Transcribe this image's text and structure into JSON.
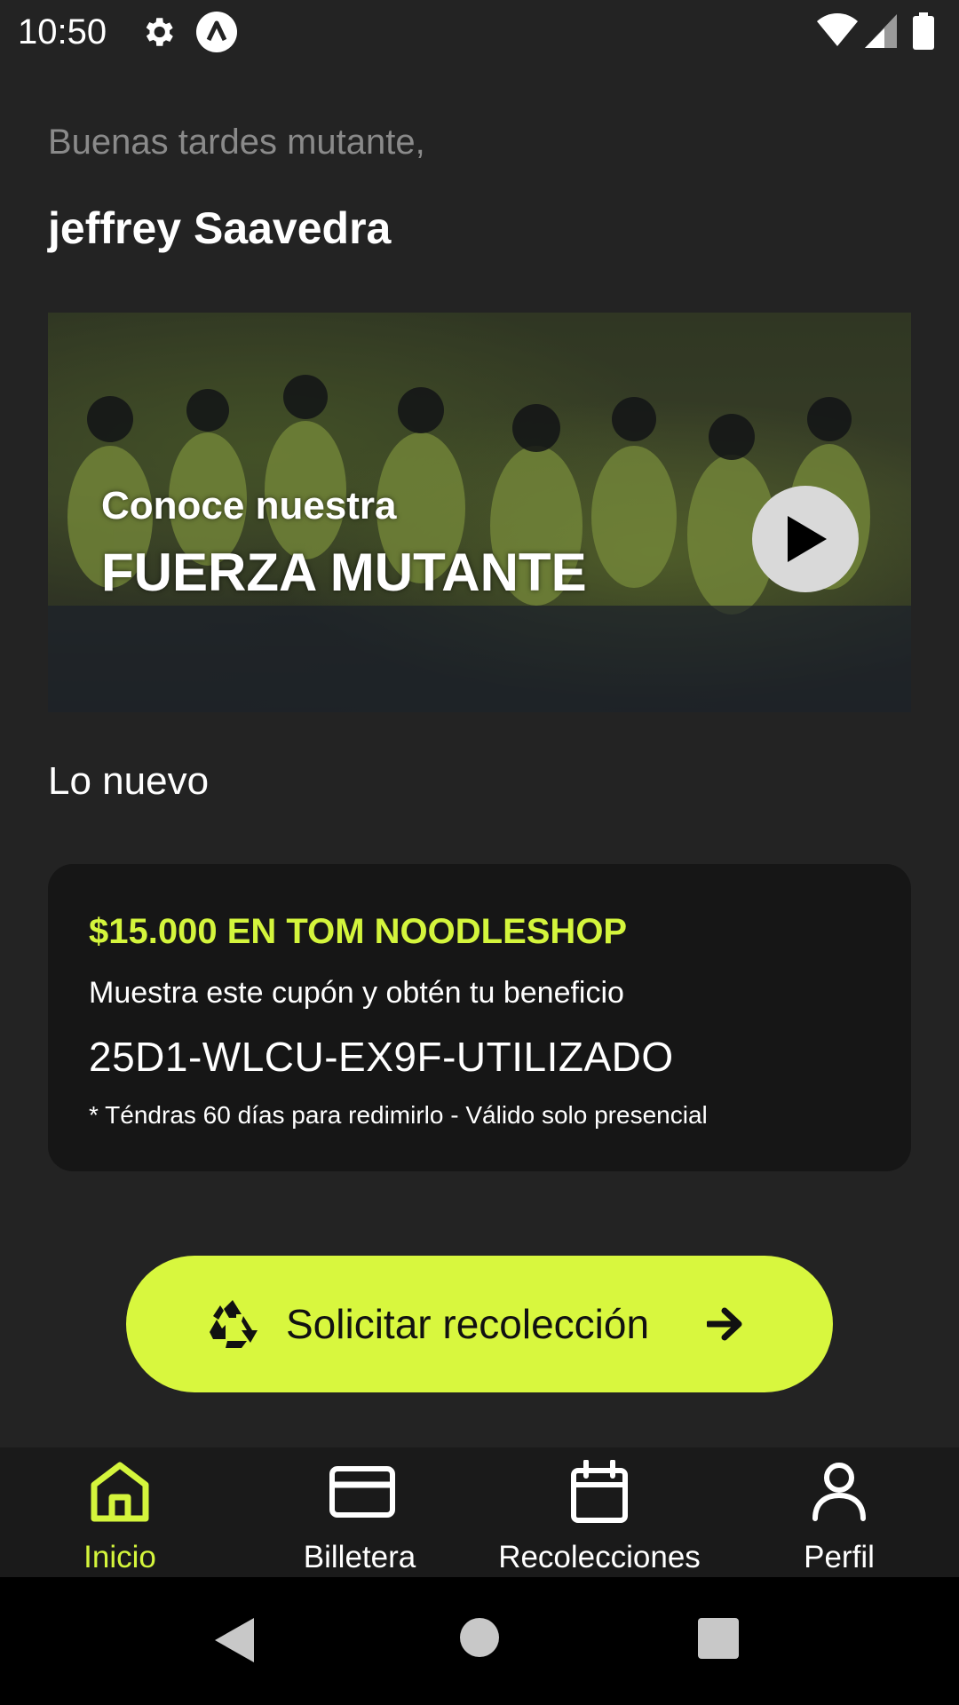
{
  "status_bar": {
    "time": "10:50",
    "icons": [
      "gear-icon",
      "app-notification-icon",
      "wifi-icon",
      "signal-icon",
      "battery-icon"
    ]
  },
  "header": {
    "greeting": "Buenas tardes mutante,",
    "user_name": "jeffrey Saavedra"
  },
  "video_banner": {
    "line1": "Conoce nuestra",
    "line2": "FUERZA MUTANTE",
    "icon": "play-icon"
  },
  "news": {
    "section_title": "Lo nuevo",
    "coupon": {
      "title": "$15.000 EN TOM NOODLESHOP",
      "description": "Muestra este cupón y obtén tu beneficio",
      "code": "25D1-WLCU-EX9F-UTILIZADO",
      "note": "* Téndras 60 días para redimirlo - Válido solo presencial"
    }
  },
  "cta": {
    "label": "Solicitar recolección",
    "icons": [
      "recycle-icon",
      "arrow-right-icon"
    ]
  },
  "bottom_nav": {
    "items": [
      {
        "label": "Inicio",
        "icon": "home-icon",
        "active": true
      },
      {
        "label": "Billetera",
        "icon": "wallet-card-icon",
        "active": false
      },
      {
        "label": "Recolecciones",
        "icon": "calendar-icon",
        "active": false
      },
      {
        "label": "Perfil",
        "icon": "user-icon",
        "active": false
      }
    ]
  },
  "colors": {
    "background": "#232323",
    "accent": "#d8f73e",
    "card": "#161616",
    "nav_background": "#1a1a1a"
  }
}
